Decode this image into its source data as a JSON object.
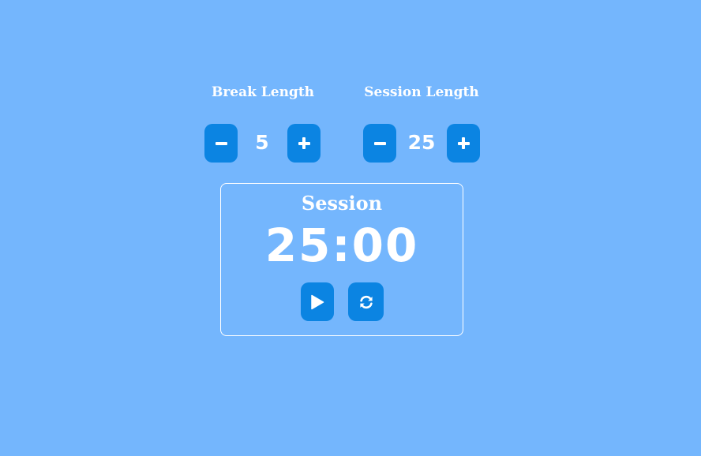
{
  "break": {
    "label": "Break Length",
    "value": "5",
    "decrement_icon": "minus-icon",
    "increment_icon": "plus-icon"
  },
  "session": {
    "label": "Session Length",
    "value": "25",
    "decrement_icon": "minus-icon",
    "increment_icon": "plus-icon"
  },
  "timer": {
    "label": "Session",
    "time_left": "25:00",
    "start_stop_icon": "play-icon",
    "reset_icon": "refresh-icon"
  },
  "colors": {
    "background": "#74b6fd",
    "button": "#0b84e2",
    "text": "#ffffff"
  }
}
